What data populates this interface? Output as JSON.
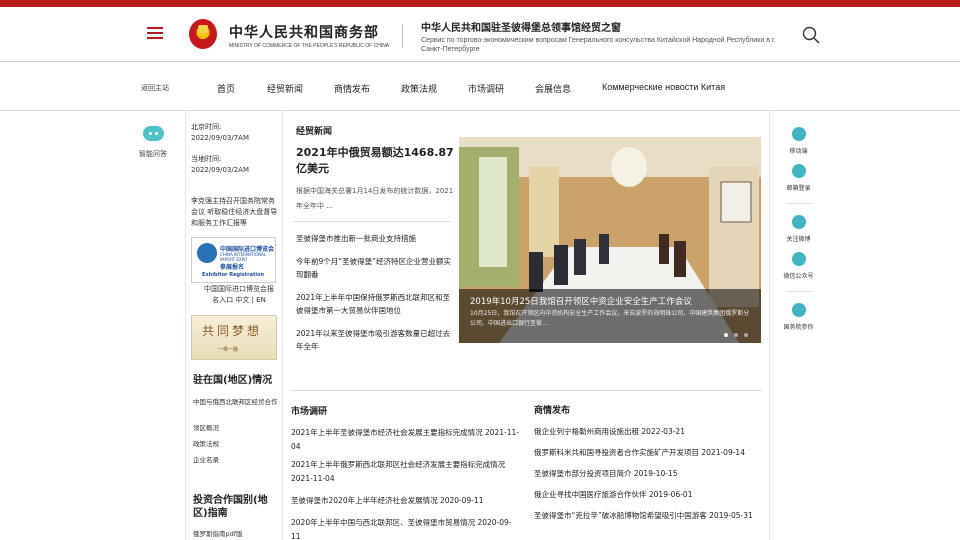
{
  "header": {
    "ministry_cn": "中华人民共和国商务部",
    "ministry_en": "MINISTRY OF COMMERCE OF THE PEOPLE'S REPUBLIC OF CHINA",
    "site_cn": "中华人民共和国驻圣彼得堡总领事馆经贸之窗",
    "site_ru": "Сервис по торгово-экономическим вопросам Генерального консульства Китайской Народной Республики в г. Санкт-Петербурге"
  },
  "nav": {
    "back": "返回主站",
    "items": [
      "首页",
      "经贸新闻",
      "商情发布",
      "政策法规",
      "市场调研",
      "会展信息",
      "Коммерческие новости Китая"
    ]
  },
  "left": {
    "robot_label": "智能问答"
  },
  "sidebar": {
    "beijing_label": "北京时间:",
    "beijing_time": "2022/09/03/7AM",
    "local_label": "当地时间:",
    "local_time": "2022/09/03/2AM",
    "news": "李克强主持召开国务院常务会议 听取稳住经济大盘督导和服务工作汇报等",
    "expo_cn": "中国国际进口博览会",
    "expo_en": "CHINA INTERNATIONAL IMPORT EXPO",
    "expo_reg_cn": "参展报名",
    "expo_reg_en": "Exhibitor Registration",
    "expo_caption": "中国国际进口博览会报名入口 中文 | EN",
    "dream_text": "共同梦想",
    "dream_sub": "一带一路",
    "section1_title": "驻在国(地区)情况",
    "section1_links": [
      "中国与俄西北联邦区经贸合作",
      "领区概况",
      "政策法规",
      "企业名录"
    ],
    "section2_title": "投资合作国别(地区)指南",
    "section2_link": "俄罗斯指南pdf版"
  },
  "main": {
    "heading": "经贸新闻",
    "feature_title": "2021年中俄贸易额达1468.87亿美元",
    "feature_summary": "根据中国海关总署1月14日发布的统计数据，2021年全年中 ...",
    "news": [
      "圣彼得堡市推出新一批商业支持措施",
      "今年前9个月“圣彼得堡”经济特区企业营业额实现翻番",
      "2021年上半年中国保持俄罗斯西北联邦区和圣彼得堡市第一大贸易伙伴国地位",
      "2021年以来圣彼得堡市吸引游客数量已超过去年全年"
    ],
    "slide_title": "2019年10月25日我馆召开领区中资企业安全生产工作会议",
    "slide_desc": "10月25日，我馆召开领区内中资机构安全生产工作会议。来自波罗的海明珠公司、中国建筑集团俄罗斯分公司、中国进出口银行圣彼..."
  },
  "research": {
    "title": "市场调研",
    "items": [
      "2021年上半年圣彼得堡市经济社会发展主要指标完成情况 2021-11-04",
      "2021年上半年俄罗斯西北联邦区社会经济发展主要指标完成情况 2021-11-04",
      "圣彼得堡市2020年上半年经济社会发展情况 2020-09-11",
      "2020年上半年中国与西北联邦区、圣彼得堡市贸易情况 2020-09-11"
    ]
  },
  "commerce": {
    "title": "商情发布",
    "items": [
      "俄企业列宁格勒州商用设施出租 2022-03-21",
      "俄罗斯科米共和国寻投资者合作实施矿产开发项目 2021-09-14",
      "圣彼得堡市部分投资项目简介 2019-10-15",
      "俄企业寻找中国医疗旅游合作伙伴 2019-06-01",
      "圣彼得堡市“克拉辛”破冰船博物馆希望吸引中国游客 2019-05-31"
    ]
  },
  "right": {
    "items": [
      "移动端",
      "邮箱登录",
      "关注微博",
      "微信公众号",
      "国务院参你"
    ]
  },
  "colors": {
    "brand_red": "#b81b1b",
    "accent_teal": "#4cc3c6"
  }
}
